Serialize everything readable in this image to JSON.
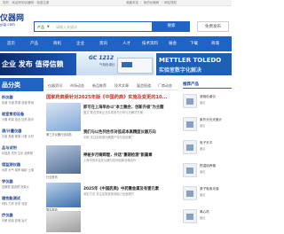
{
  "topbar": {
    "left": "您好，欢迎来到仪器网 · 免费注册",
    "right": "收藏本站 ｜ 我的仪器网 ｜ 网站导航"
  },
  "logo": {
    "title": "仪器网",
    "url": "yiqi.com"
  },
  "search": {
    "category": "产品",
    "placeholder": "请输入关键词",
    "button": "搜索",
    "publish": "免费发布"
  },
  "nav": [
    "首页",
    "产品",
    "商机",
    "企业",
    "资讯",
    "人才",
    "技术资料",
    "展会",
    "下载",
    "商城"
  ],
  "banners": {
    "left": "企业 发布 值得信赖",
    "middle_title": "GC 1212",
    "middle_sub": "气相色谱仪",
    "right_title": "METTLER TOLEDO",
    "right_sub": "实验室数字化解决"
  },
  "sidebar": {
    "title": "品分类",
    "categories": [
      {
        "name": "析仪器",
        "sub": "色谱 光谱 质谱 波谱 联用"
      },
      {
        "name": "验室常用设备",
        "sub": "分离 称量 混合 加热 制冷"
      },
      {
        "name": "测/计量仪器",
        "sub": "长度 角度 硬度 计数 计时"
      },
      {
        "name": "品与试剂",
        "sub": "标准品 试剂 生化 培养基"
      },
      {
        "name": "境监测仪器",
        "sub": "水质 大气 噪声 辐射 土壤"
      },
      {
        "name": "学仪器",
        "sub": "显微镜 望远镜 测量仪"
      },
      {
        "name": "理性能测试",
        "sub": "材料 力学 热学 流变"
      },
      {
        "name": "疗仪器",
        "sub": "诊断 检验 影像 治疗"
      }
    ]
  },
  "center": {
    "tabs": [
      "仪器资讯",
      "市场动态",
      "新品推荐",
      "技术文章",
      "展会报道",
      "厂商动态"
    ],
    "headline": "国家药典委针对2025年版《中国药典》实施及变更的10...",
    "articles": [
      {
        "title": "即可在上海举办以\"本土融合，创新升级\"为主题",
        "desc": "图文 联合多家企业共同参与分享行业解决方案"
      },
      {
        "title": "我们与以色列合作对低成本高精度仪器方向",
        "desc": "中欧 关注实验室仪器国产化与应用推广"
      },
      {
        "title": "神秘岁月铸辉煌，共话\"重磅检测\"新篇章",
        "desc": "上海市资本会在仪器与检测创新领域合作"
      },
      {
        "title": "2025年《中国药典》中药重金属及有害元素",
        "desc": "测定方法 关注实验室检测能力全面提升"
      }
    ],
    "captions": [
      "第三方仪器行业动态",
      "行业资讯",
      "展会报道",
      "技术应用"
    ]
  },
  "right": {
    "title": "推荐产品",
    "items": [
      {
        "name": "液相色谱仪",
        "price": "面议"
      },
      {
        "name": "紫外分光光度计",
        "price": "面议"
      },
      {
        "name": "电子天平",
        "price": "面议"
      },
      {
        "name": "恒温培养箱",
        "price": "面议"
      },
      {
        "name": "原子吸收光谱",
        "price": "面议"
      },
      {
        "name": "离心机",
        "price": "面议"
      }
    ]
  },
  "colors": {
    "brand": "#1f63c4",
    "headline": "#c0392b",
    "dark": "#1a3f8f"
  }
}
